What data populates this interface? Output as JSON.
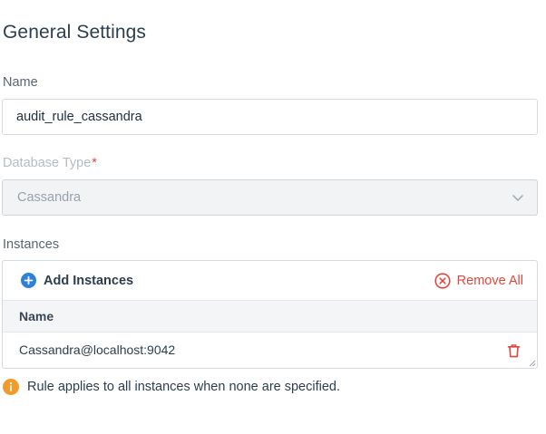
{
  "section": {
    "title": "General Settings"
  },
  "name_field": {
    "label": "Name",
    "value": "audit_rule_cassandra"
  },
  "database_type": {
    "label": "Database Type",
    "required_mark": "*",
    "selected": "Cassandra",
    "disabled": true
  },
  "instances": {
    "label": "Instances",
    "add_label": "Add Instances",
    "remove_all_label": "Remove All",
    "columns": [
      "Name"
    ],
    "rows": [
      {
        "name": "Cassandra@localhost:9042"
      }
    ]
  },
  "hint": {
    "text": "Rule applies to all instances when none are specified."
  },
  "icons": {
    "add": "plus-circle-icon",
    "remove_all": "x-circle-icon",
    "row_delete": "trash-icon",
    "select": "chevron-down-icon",
    "hint": "info-circle-icon"
  },
  "colors": {
    "primary": "#2f80d8",
    "danger": "#e0483d",
    "warning": "#f29b2a"
  }
}
